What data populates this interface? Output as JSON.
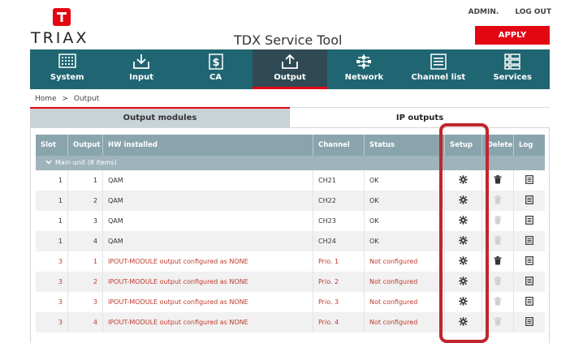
{
  "header": {
    "brand": "TRIAX",
    "app_title": "TDX Service Tool",
    "user": "ADMIN.",
    "logout": "LOG OUT",
    "apply": "APPLY"
  },
  "nav": [
    {
      "label": "System",
      "icon": "system-grid-icon"
    },
    {
      "label": "Input",
      "icon": "input-tray-icon"
    },
    {
      "label": "CA",
      "icon": "ca-dollar-icon"
    },
    {
      "label": "Output",
      "icon": "output-tray-icon",
      "active": true
    },
    {
      "label": "Network",
      "icon": "network-icon"
    },
    {
      "label": "Channel list",
      "icon": "channel-list-icon"
    },
    {
      "label": "Services",
      "icon": "services-icon"
    }
  ],
  "breadcrumb": {
    "home": "Home",
    "sep": ">",
    "current": "Output"
  },
  "tabs": {
    "output_modules": "Output modules",
    "ip_outputs": "IP outputs"
  },
  "table": {
    "headers": {
      "slot": "Slot",
      "output": "Output",
      "hw": "HW installed",
      "channel": "Channel",
      "status": "Status",
      "setup": "Setup",
      "delete": "Delete",
      "log": "Log"
    },
    "group": "Main unit (8 items)",
    "rows": [
      {
        "slot": "1",
        "output": "1",
        "hw": "QAM",
        "channel": "CH21",
        "status": "OK",
        "delete_enabled": true
      },
      {
        "slot": "1",
        "output": "2",
        "hw": "QAM",
        "channel": "CH22",
        "status": "OK",
        "delete_enabled": false
      },
      {
        "slot": "1",
        "output": "3",
        "hw": "QAM",
        "channel": "CH23",
        "status": "OK",
        "delete_enabled": false
      },
      {
        "slot": "1",
        "output": "4",
        "hw": "QAM",
        "channel": "CH24",
        "status": "OK",
        "delete_enabled": false
      },
      {
        "slot": "3",
        "output": "1",
        "hw": "IPOUT-MODULE output configured as NONE",
        "channel": "Prio. 1",
        "status": "Not configured",
        "delete_enabled": true
      },
      {
        "slot": "3",
        "output": "2",
        "hw": "IPOUT-MODULE output configured as NONE",
        "channel": "Prio. 2",
        "status": "Not configured",
        "delete_enabled": false
      },
      {
        "slot": "3",
        "output": "3",
        "hw": "IPOUT-MODULE output configured as NONE",
        "channel": "Prio. 3",
        "status": "Not configured",
        "delete_enabled": false
      },
      {
        "slot": "3",
        "output": "4",
        "hw": "IPOUT-MODULE output configured as NONE",
        "channel": "Prio. 4",
        "status": "Not configured",
        "delete_enabled": false
      }
    ]
  },
  "colors": {
    "accent": "#e30613",
    "nav": "#1f6672",
    "nav_active": "#2f4a54",
    "table_header": "#8aa4ad",
    "error_text": "#c0392b",
    "highlight": "#c0262d"
  }
}
